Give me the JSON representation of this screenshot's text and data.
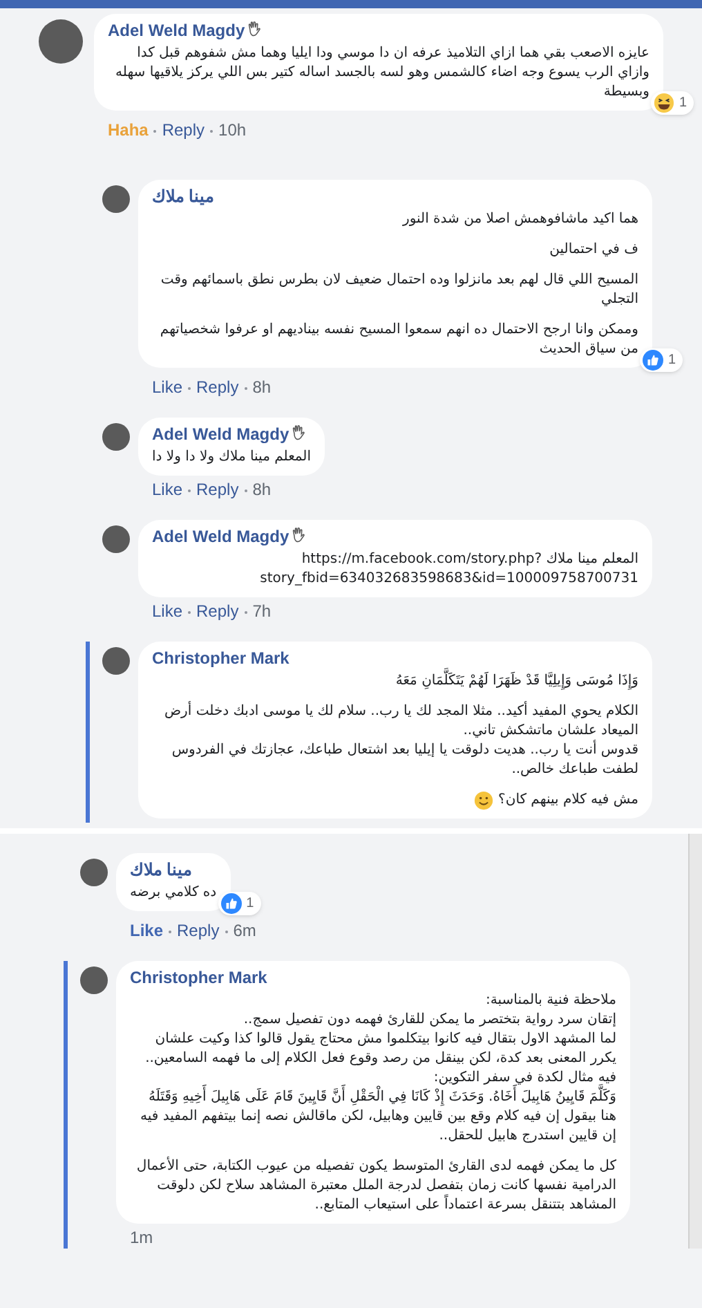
{
  "sections": [
    {
      "comments": [
        {
          "author": "Adel Weld Magdy",
          "hand_badge": true,
          "highlighted": false,
          "blocks": [
            [
              "عايزه الاصعب بقي هما ازاي التلاميذ عرفه ان دا موسي ودا ايليا وهما مش شفوهم قبل كدا وازاي الرب يسوع وجه اضاء كالشمس وهو لسه بالجسد اساله كتير بس اللي يركز يلاقيها سهله وبسيطة"
            ]
          ],
          "reaction": {
            "kind": "haha",
            "count": "1"
          },
          "react_button": {
            "label": "Haha",
            "kind": "haha",
            "reacted": true
          },
          "reply": "Reply",
          "time": "10h",
          "children": [
            {
              "author": "مينا ملاك",
              "hand_badge": false,
              "highlighted": false,
              "blocks": [
                [
                  "هما اكيد ماشافوهمش اصلا من شدة النور"
                ],
                [
                  "ف في احتمالين"
                ],
                [
                  "المسيح اللي قال لهم بعد مانزلوا وده احتمال ضعيف لان بطرس نطق باسمائهم وقت التجلي"
                ],
                [
                  "وممكن وانا ارجح الاحتمال ده انهم سمعوا المسيح نفسه بيناديهم او عرفوا شخصياتهم من سياق الحديث"
                ]
              ],
              "reaction": {
                "kind": "like",
                "count": "1"
              },
              "react_button": {
                "label": "Like",
                "reacted": false
              },
              "reply": "Reply",
              "time": "8h"
            },
            {
              "author": "Adel Weld Magdy",
              "hand_badge": true,
              "highlighted": false,
              "blocks": [
                [
                  "المعلم مينا ملاك ولا دا ولا دا"
                ]
              ],
              "react_button": {
                "label": "Like",
                "reacted": false
              },
              "reply": "Reply",
              "time": "8h"
            },
            {
              "author": "Adel Weld Magdy",
              "hand_badge": true,
              "highlighted": false,
              "blocks": [
                [
                  "المعلم مينا ملاك https://m.facebook.com/story.php?story_fbid=634032683598683&id=100009758700731"
                ]
              ],
              "react_button": {
                "label": "Like",
                "reacted": false
              },
              "reply": "Reply",
              "time": "7h"
            },
            {
              "author": "Christopher Mark",
              "hand_badge": false,
              "highlighted": true,
              "blocks": [
                [
                  "وَإِذَا مُوسَى وَإِيلِيَّا قَدْ ظَهَرَا لَهُمْ يَتَكَلَّمَانِ مَعَهُ"
                ],
                [
                  "الكلام يحوي المفيد أكيد.. مثلا المجد لك يا رب.. سلام لك يا موسى ادبك دخلت أرض الميعاد علشان ماتشكش تاني..",
                  "قدوس أنت يا رب.. هديت دلوقت يا إيليا بعد اشتعال طباعك، عجازتك في الفردوس لطفت طباعك خالص.."
                ],
                [
                  "مش فيه كلام بينهم كان؟"
                ]
              ],
              "smiley": true
            }
          ]
        }
      ]
    },
    {
      "comments": [
        {
          "author": "مينا ملاك",
          "hand_badge": false,
          "highlighted": false,
          "blocks": [
            [
              "ده كلامي برضه"
            ]
          ],
          "reaction": {
            "kind": "like",
            "count": "1"
          },
          "react_button": {
            "label": "Like",
            "kind": "like",
            "reacted": true
          },
          "reply": "Reply",
          "time": "6m"
        },
        {
          "author": "Christopher Mark",
          "hand_badge": false,
          "highlighted": true,
          "blocks": [
            [
              "ملاحظة فنية بالمناسبة:",
              "إتقان سرد رواية بتختصر ما يمكن للقارئ فهمه دون تفصيل سمج..",
              "لما المشهد الاول بتقال فيه كانوا بيتكلموا مش محتاج يقول قالوا كذا وكيت علشان يكرر المعنى بعد كدة، لكن بينقل من رصد وقوع فعل الكلام إلى ما فهمه السامعين..",
              "فيه مثال لكدة في سفر التكوين:",
              "وَكَلَّمَ قَايِينُ هَابِيلَ أَخَاهُ. وَحَدَثَ إِذْ كَانَا فِي الْحَقْلِ أَنَّ قَايِينَ قَامَ عَلَى هَابِيلَ أَخِيهِ وَقَتَلَهُ",
              "هنا بيقول إن فيه كلام وقع بين قايين وهابيل، لكن ماقالش نصه إنما بيتفهم المفيد فيه إن قايين استدرج هابيل للحقل.."
            ],
            [
              "كل ما يمكن فهمه لدى القارئ المتوسط يكون تفصيله من عيوب الكتابة، حتى الأعمال الدرامية نفسها كانت زمان بتفصل لدرجة الملل معتبرة المشاهد سلاح لكن دلوقت المشاهد بتتنقل بسرعة اعتماداً على استيعاب المتابع.."
            ]
          ],
          "time": "1m"
        }
      ]
    }
  ]
}
